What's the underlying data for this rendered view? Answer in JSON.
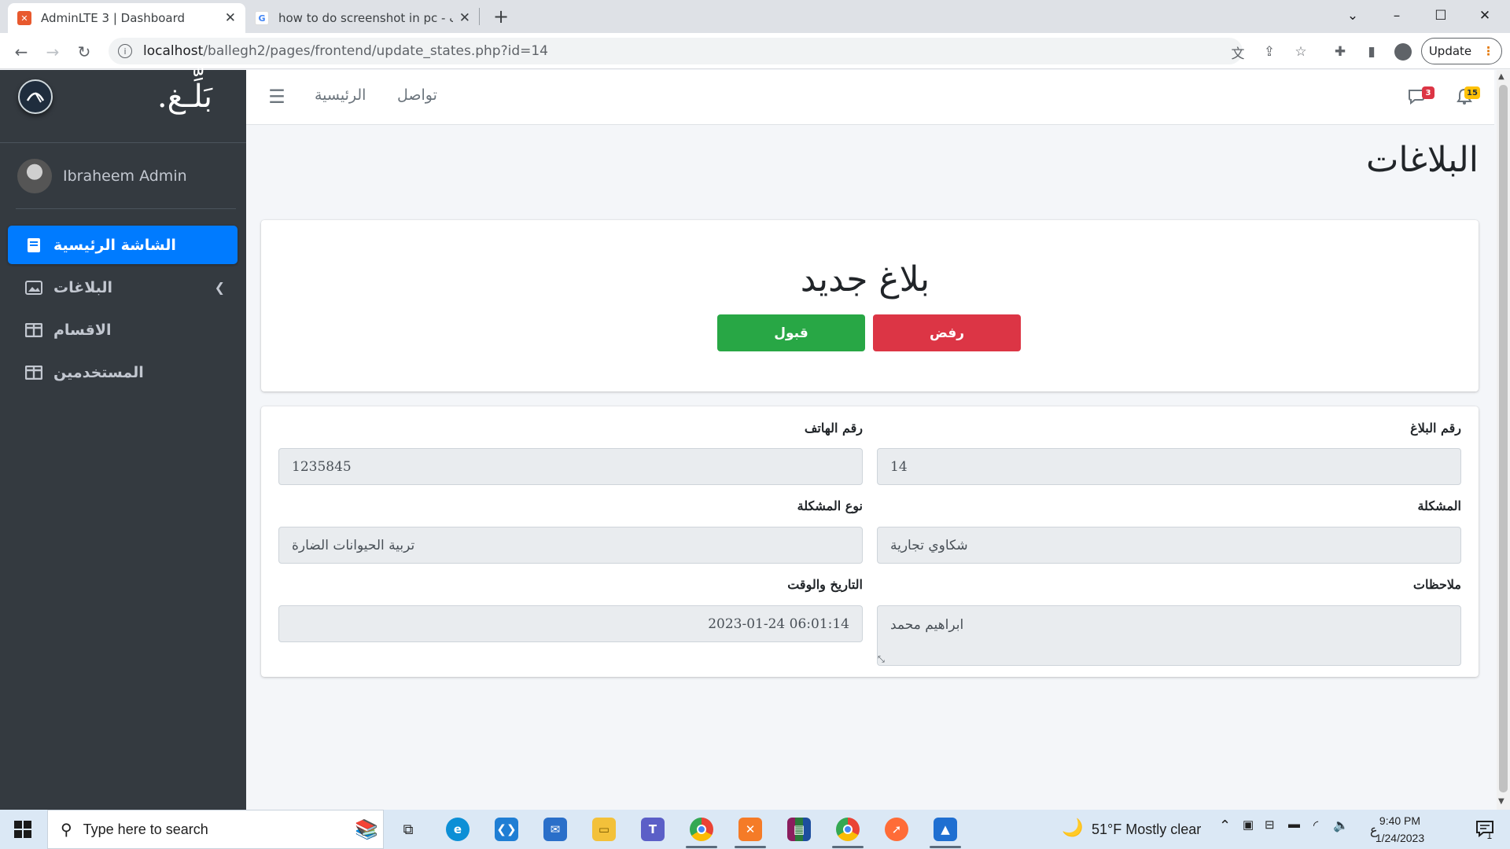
{
  "browser": {
    "tabs": [
      {
        "title": "AdminLTE 3 | Dashboard",
        "active": true
      },
      {
        "title": "how to do screenshot in pc - بحث",
        "active": false
      }
    ],
    "url_host": "localhost",
    "url_path": "/ballegh2/pages/frontend/update_states.php?id=14",
    "update_label": "Update",
    "icons": [
      "back-icon",
      "forward-icon",
      "reload-icon",
      "translate-icon",
      "share-icon",
      "star-icon",
      "extensions-icon",
      "sidepanel-icon",
      "profile-icon",
      "menu-dots-icon"
    ]
  },
  "sidebar": {
    "brand_text": "بَلِّـغ.",
    "user_name": "Ibraheem Admin",
    "items": [
      {
        "label": "الشاشة الرئيسية",
        "icon": "book-icon",
        "active": true
      },
      {
        "label": "البلاغات",
        "icon": "image-icon",
        "has_arrow": true
      },
      {
        "label": "الاقسام",
        "icon": "columns-icon"
      },
      {
        "label": "المستخدمين",
        "icon": "columns-icon"
      }
    ]
  },
  "navbar": {
    "links": [
      "الرئيسية",
      "تواصل"
    ],
    "messages_count": "3",
    "notifications_count": "15"
  },
  "content": {
    "page_title": "البلاغات",
    "status_card": {
      "title": "بلاغ جديد",
      "reject_label": "رفض",
      "accept_label": "قبول",
      "reject_color": "#dc3545",
      "accept_color": "#28a745"
    },
    "details": {
      "report_no_label": "رقم البلاغ",
      "report_no": "14",
      "phone_label": "رقم الهاتف",
      "phone": "1235845",
      "problem_label": "المشكلة",
      "problem": "شكاوي تجارية",
      "problem_type_label": "نوع المشكلة",
      "problem_type": "تربية الحيوانات الضارة",
      "notes_label": "ملاحظات",
      "notes": "ابراهيم محمد",
      "datetime_label": "التاريخ والوقت",
      "datetime": "2023-01-24 06:01:14"
    }
  },
  "taskbar": {
    "search_placeholder": "Type here to search",
    "weather": "51°F  Mostly clear",
    "ime": "ع",
    "time": "9:40 PM",
    "date": "1/24/2023",
    "notif_count": "1"
  }
}
